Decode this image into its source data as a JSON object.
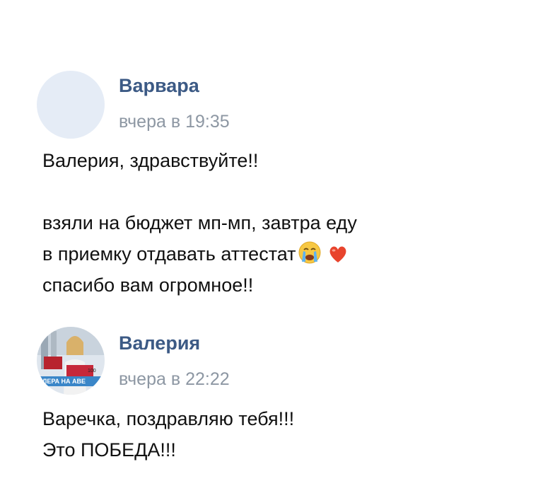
{
  "comments": [
    {
      "author": "Варвара",
      "time": "вчера в 19:35",
      "lines": [
        "Валерия, здравствуйте!!",
        "",
        "взяли на бюджет мп-мп, завтра еду",
        "в приемку отдавать аттестат",
        "спасибо вам огромное!!"
      ],
      "emojis": [
        "crying-face-icon",
        "heart-icon"
      ]
    },
    {
      "author": "Валерия",
      "time": "вчера в 22:22",
      "lines": [
        "Варечка, поздравляю тебя!!!",
        "Это ПОБЕДА!!!"
      ],
      "avatar_text": "ЛЕРА НА АВЕ",
      "avatar_badge": "100"
    }
  ],
  "colors": {
    "author": "#3c5a85",
    "time": "#8d97a3",
    "avatar_placeholder": "#e5ecf6",
    "heart": "#e8442d"
  }
}
